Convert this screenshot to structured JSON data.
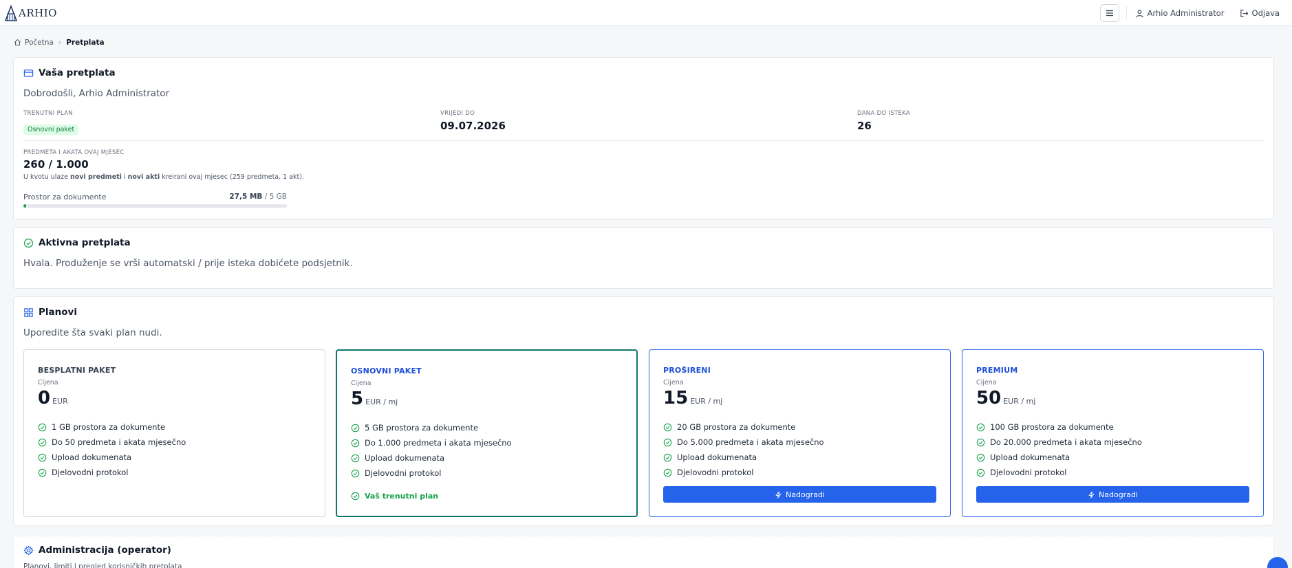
{
  "header": {
    "logo_text": "ARHIO",
    "user_label": "Arhio Administrator",
    "logout_label": "Odjava"
  },
  "breadcrumb": {
    "home": "Početna",
    "current": "Pretplata"
  },
  "subscription": {
    "title": "Vaša pretplata",
    "welcome": "Dobrodošli, Arhio Administrator",
    "current_plan_label": "TRENUTNI PLAN",
    "current_plan_value": "Osnovni paket",
    "valid_until_label": "VRIJEDI DO",
    "valid_until_value": "09.07.2026",
    "days_left_label": "DANA DO ISTEKA",
    "days_left_value": "26",
    "quota_label": "PREDMETA I AKATA OVAJ MJESEC",
    "quota_value": "260 / 1.000",
    "quota_note_1": "U kvotu ulaze ",
    "quota_note_bold_1": "novi predmeti",
    "quota_note_2": " i ",
    "quota_note_bold_2": "novi akti",
    "quota_note_3": " kreirani ovaj mjesec (259 predmeta, 1 akt).",
    "storage_label": "Prostor za dokumente",
    "storage_used": "27,5 MB",
    "storage_total": " / 5 GB",
    "storage_fraction": 0.0054
  },
  "active": {
    "title": "Aktivna pretplata",
    "text": "Hvala. Produženje se vrši automatski / prije isteka dobićete podsjetnik."
  },
  "plans": {
    "title": "Planovi",
    "subtitle": "Uporedite šta svaki plan nudi.",
    "price_label": "Cijena",
    "current_label": "Vaš trenutni plan",
    "upgrade_label": "Nadogradi",
    "items": [
      {
        "name": "BESPLATNI PAKET",
        "price": "0",
        "unit": "EUR",
        "features": [
          "1 GB prostora za dokumente",
          "Do 50 predmeta i akata mjesečno",
          "Upload dokumenata",
          "Djelovodni protokol"
        ]
      },
      {
        "name": "OSNOVNI PAKET",
        "price": "5",
        "unit": "EUR / mj",
        "features": [
          "5 GB prostora za dokumente",
          "Do 1.000 predmeta i akata mjesečno",
          "Upload dokumenata",
          "Djelovodni protokol"
        ]
      },
      {
        "name": "PROŠIRENI",
        "price": "15",
        "unit": "EUR / mj",
        "features": [
          "20 GB prostora za dokumente",
          "Do 5.000 predmeta i akata mjesečno",
          "Upload dokumenata",
          "Djelovodni protokol"
        ]
      },
      {
        "name": "PREMIUM",
        "price": "50",
        "unit": "EUR / mj",
        "features": [
          "100 GB prostora za dokumente",
          "Do 20.000 predmeta i akata mjesečno",
          "Upload dokumenata",
          "Djelovodni protokol"
        ]
      }
    ]
  },
  "admin": {
    "title": "Administracija (operator)",
    "subtitle": "Planovi, limiti i pregled korisničkih pretplata"
  },
  "colors": {
    "accent": "#2563eb",
    "success": "#16a34a",
    "current_border": "#0f766e"
  }
}
